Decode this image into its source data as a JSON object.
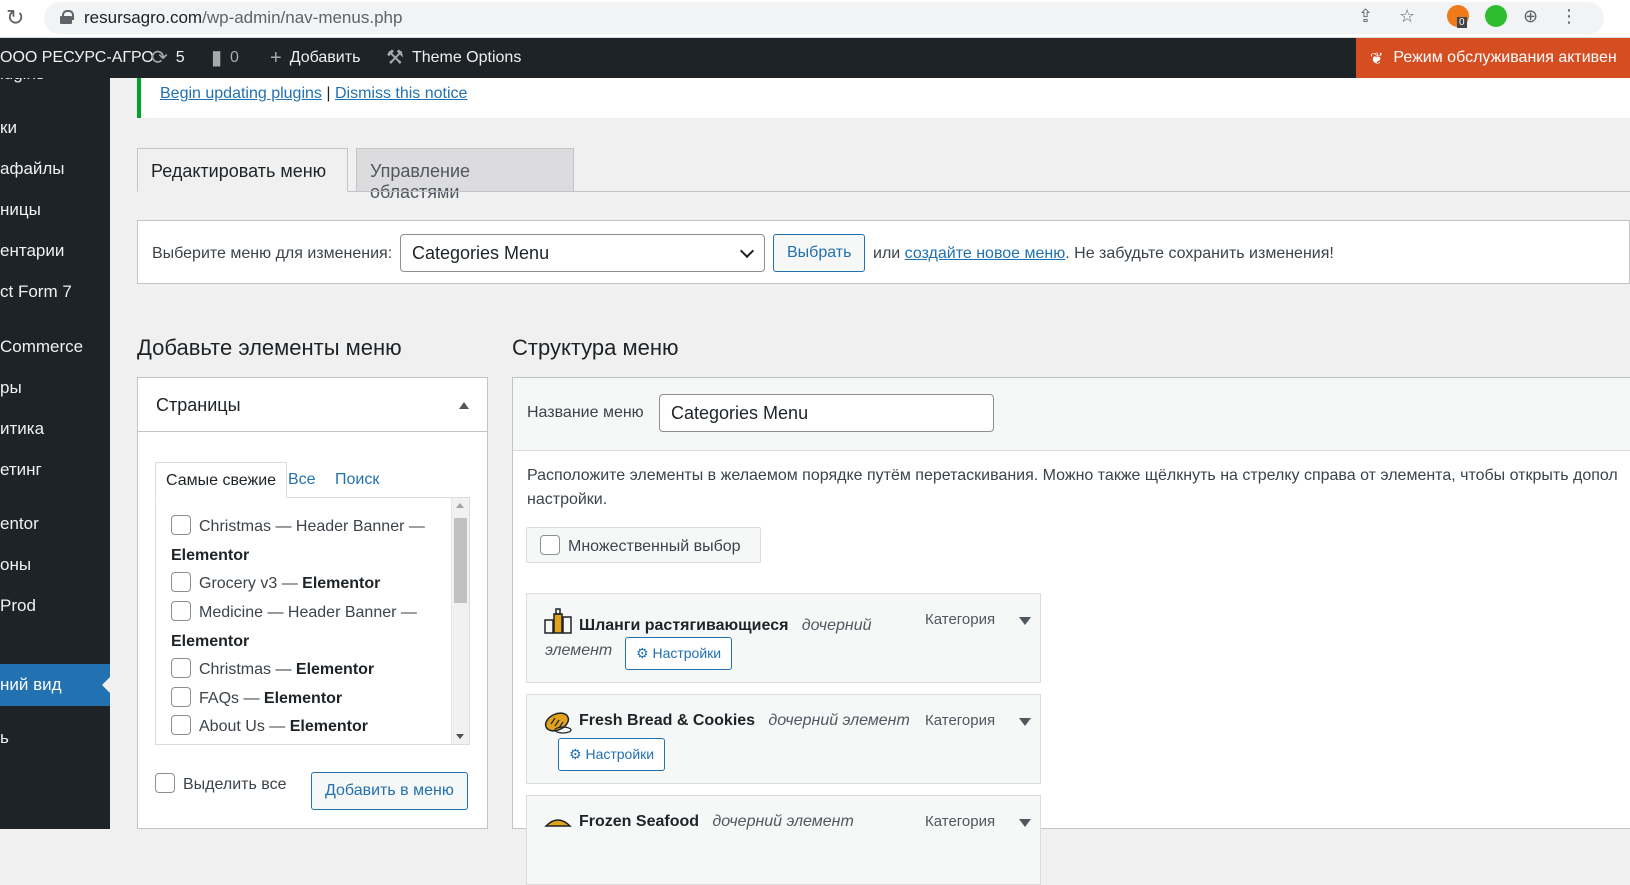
{
  "browser": {
    "url_host": "resursagro.com",
    "url_path": "/wp-admin/nav-menus.php",
    "ext_badge": "0"
  },
  "adminbar": {
    "site_name": "ООО РЕСУРС-АГРО",
    "updates_count": "5",
    "comments_count": "0",
    "new_label": "Добавить",
    "theme_options": "Theme Options",
    "maintenance": "Режим обслуживания активен"
  },
  "sidebar": {
    "items": [
      "lugins",
      "ки",
      "афайлы",
      "ницы",
      "ентарии",
      "ct Form 7",
      "Commerce",
      "ры",
      "итика",
      "етинг",
      "entor",
      "оны",
      "Prod",
      "ний вид",
      "ь"
    ]
  },
  "notice": {
    "begin_link": "Begin updating plugins",
    "separator": "|",
    "dismiss_link": "Dismiss this notice"
  },
  "tabs": {
    "edit": "Редактировать меню",
    "manage": "Управление областями"
  },
  "manage": {
    "label": "Выберите меню для изменения:",
    "selected_menu": "Categories Menu",
    "select_button": "Выбрать",
    "or": "или",
    "create_link": "создайте новое меню",
    "after": ". Не забудьте сохранить изменения!"
  },
  "add_items": {
    "heading": "Добавьте элементы меню",
    "box_title": "Страницы",
    "tab_recent": "Самые свежие",
    "tab_all": "Все",
    "tab_search": "Поиск",
    "pages": [
      {
        "name": "Christmas — Header Banner —",
        "suffix": "Elementor"
      },
      {
        "name": "Grocery v3 —",
        "suffix": "Elementor"
      },
      {
        "name": "Medicine — Header Banner —",
        "suffix": "Elementor"
      },
      {
        "name": "Christmas —",
        "suffix": "Elementor"
      },
      {
        "name": "FAQs —",
        "suffix": "Elementor"
      },
      {
        "name": "About Us —",
        "suffix": "Elementor"
      }
    ],
    "select_all": "Выделить все",
    "add_button": "Добавить в меню"
  },
  "structure": {
    "heading": "Структура меню",
    "name_label": "Название меню",
    "name_value": "Categories Menu",
    "desc_line1": "Расположите элементы в желаемом порядке путём перетаскивания. Можно также щёлкнуть на стрелку справа от элемента, чтобы открыть допол",
    "desc_line2": "настройки.",
    "multi_select": "Множественный выбор",
    "items": [
      {
        "title": "Шланги растягивающиеся",
        "sub": "дочерний",
        "sub2": "элемент",
        "type": "Категория",
        "settings": "Настройки",
        "icon": "drinks-bottles-icon"
      },
      {
        "title": "Fresh Bread & Cookies",
        "sub": "дочерний элемент",
        "type": "Категория",
        "settings": "Настройки",
        "icon": "bread-icon"
      },
      {
        "title": "Frozen Seafood",
        "sub": "дочерний элемент",
        "type": "Категория",
        "icon": "seafood-icon"
      }
    ]
  },
  "colors": {
    "admin_bar": "#1d2327",
    "accent_blue": "#2271b1",
    "maintenance": "#d54e21",
    "notice_border": "#00a32a"
  }
}
